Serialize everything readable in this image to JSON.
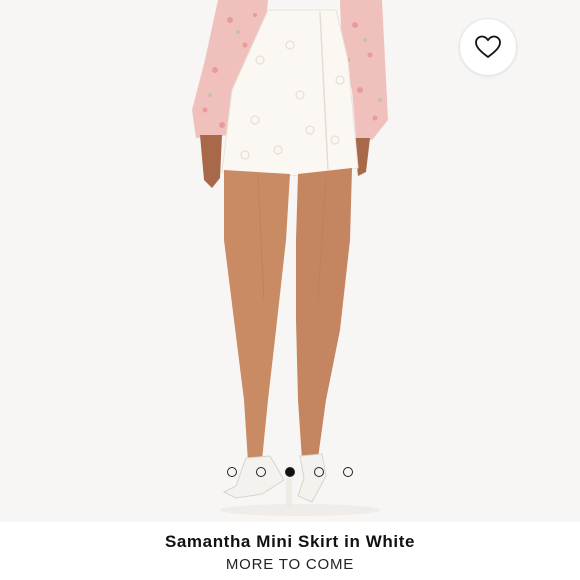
{
  "product": {
    "title": "Samantha Mini Skirt in White",
    "status": "MORE TO COME"
  },
  "wishlist": {
    "icon": "heart-outline-icon"
  },
  "carousel": {
    "total": 5,
    "active_index": 2
  },
  "colors": {
    "skirt": "#fbf8f3",
    "blouse_pink": "#f2b8b8",
    "skin": "#c98b64",
    "background": "#f7f6f4"
  }
}
